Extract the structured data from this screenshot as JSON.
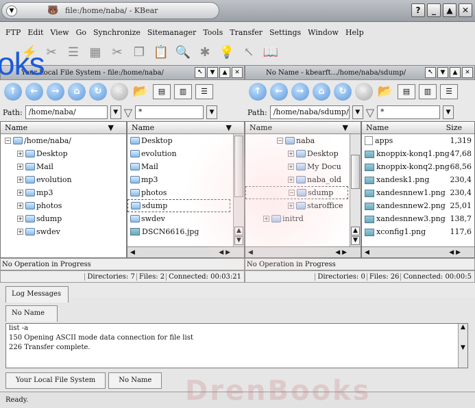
{
  "window": {
    "title": "file:/home/naba/ - KBear",
    "buttons": [
      "?",
      "_",
      "▲",
      "✕"
    ]
  },
  "menubar": [
    "FTP",
    "Edit",
    "View",
    "Go",
    "Synchronize",
    "Sitemanager",
    "Tools",
    "Transfer",
    "Settings",
    "Window",
    "Help"
  ],
  "watermark": "oks",
  "bg_watermark": "DrenBooks",
  "left_panel": {
    "title": "Your Local File System - file:/home/naba/",
    "path_label": "Path:",
    "path_value": "/home/naba/",
    "filter_value": "*",
    "tree_header": "Name",
    "tree": [
      "/home/naba/",
      "Desktop",
      "Mail",
      "evolution",
      "mp3",
      "photos",
      "sdump",
      "swdev"
    ],
    "list_header": "Name",
    "list": [
      "Desktop",
      "evolution",
      "Mail",
      "mp3",
      "photos",
      "sdump",
      "swdev",
      "DSCN6616.jpg"
    ],
    "status_left": "No Operation in Progress",
    "directories": "Directories: 7",
    "files": "Files: 2",
    "connected": "Connected: 00:03:21"
  },
  "right_panel": {
    "title": "No Name - kbearft.../home/naba/sdump/",
    "path_label": "Path:",
    "path_value": "/home/naba/sdump/",
    "filter_value": "*",
    "tree_header": "Name",
    "tree": [
      "naba",
      "Desktop",
      "My Docu",
      "naba_old",
      "sdump",
      "staroffice",
      "initrd"
    ],
    "list_header": "Name",
    "size_header": "Size",
    "list": [
      {
        "name": "apps",
        "size": "1,319"
      },
      {
        "name": "knoppix-konq1.png",
        "size": "47,68"
      },
      {
        "name": "knoppix-konq2.png",
        "size": "68,56"
      },
      {
        "name": "xandesk1.png",
        "size": "230,4"
      },
      {
        "name": "xandesnnew1.png",
        "size": "230,4"
      },
      {
        "name": "xandesnnew2.png",
        "size": "25,01"
      },
      {
        "name": "xandesnnew3.png",
        "size": "138,7"
      },
      {
        "name": "xconfig1.png",
        "size": "117,6"
      }
    ],
    "status_left": "No Operation in Progress",
    "directories": "Directories: 0",
    "files": "Files: 26",
    "connected": "Connected: 00:00:5"
  },
  "log": {
    "tab_label": "Log Messages",
    "subtab_label": "No Name",
    "lines": [
      "list -a",
      "150 Opening ASCII mode data connection for file list",
      "226 Transfer complete."
    ]
  },
  "bottom_tabs": [
    "Your Local File System",
    "No Name"
  ],
  "status": "Ready."
}
